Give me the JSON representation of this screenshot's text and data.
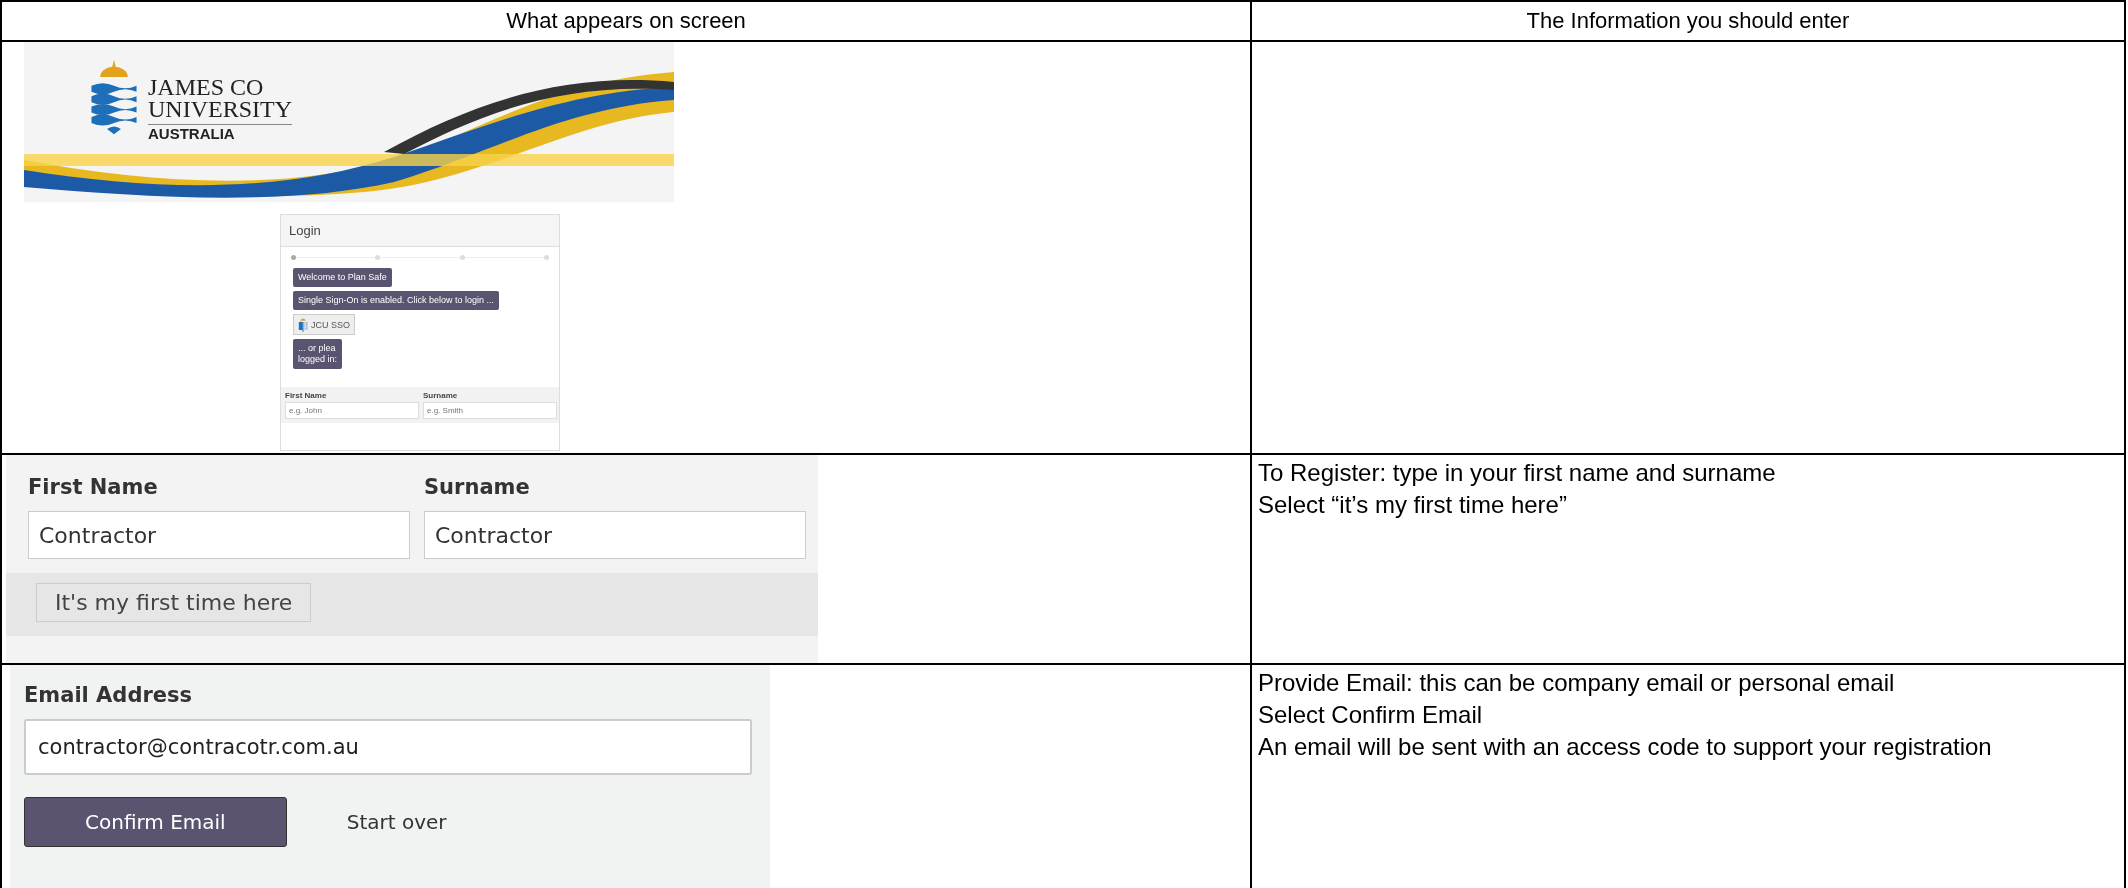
{
  "table": {
    "columns": [
      "What appears on screen",
      "The Information you should enter"
    ],
    "rows": [
      {
        "screen": {
          "kind": "login",
          "logo": [
            "JAMES CO",
            "UNIVERSITY",
            "AUSTRALIA"
          ],
          "card_title": "Login",
          "messages": [
            "Welcome to Plan Safe",
            "Single Sign-On is enabled. Click below to login ..."
          ],
          "sso_button": "JCU SSO",
          "note": [
            "... or plea",
            "logged in:"
          ],
          "fields": [
            {
              "label": "First Name",
              "placeholder": "e.g. John"
            },
            {
              "label": "Surname",
              "placeholder": "e.g. Smith"
            }
          ]
        }
      },
      {
        "screen": {
          "kind": "name",
          "fields": [
            {
              "label": "First Name",
              "value": "Contractor"
            },
            {
              "label": "Surname",
              "value": "Contractor"
            }
          ],
          "button": "It's my first time here"
        },
        "instructions": [
          "To Register: type in your first name and surname",
          "Select “it’s my first time here”"
        ]
      },
      {
        "screen": {
          "kind": "email",
          "field": {
            "label": "Email Address",
            "value": "contractor@contracotr.com.au"
          },
          "button": "Confirm Email",
          "link": "Start over"
        },
        "instructions": [
          "Provide Email: this can be company email or personal email",
          "Select Confirm Email",
          "An email will be sent with an access code to support your registration"
        ]
      }
    ]
  }
}
